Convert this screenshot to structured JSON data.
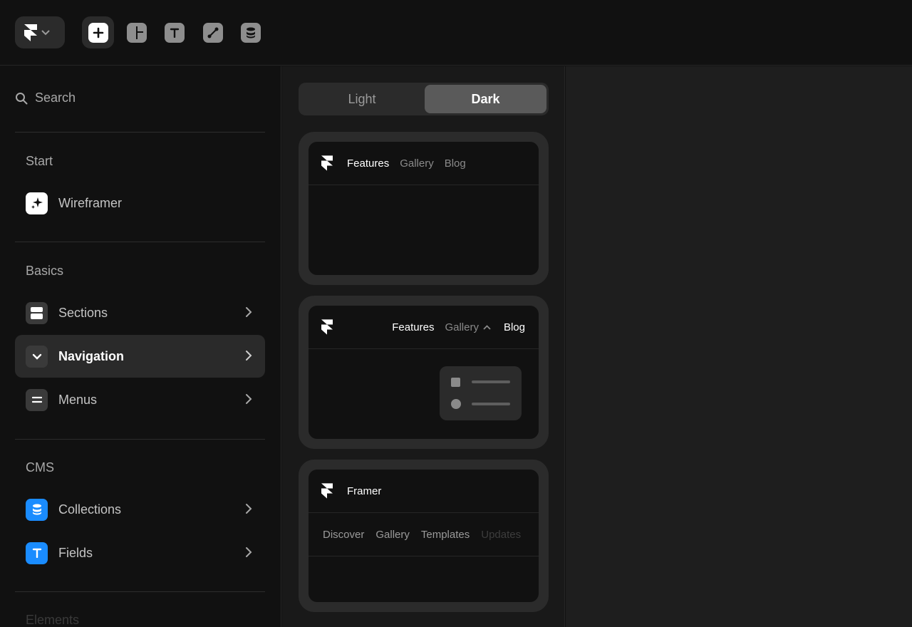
{
  "toolbar": {
    "tools": [
      {
        "icon": "plus-icon",
        "active": true
      },
      {
        "icon": "layout-icon",
        "active": false
      },
      {
        "icon": "text-icon",
        "active": false
      },
      {
        "icon": "vector-icon",
        "active": false
      },
      {
        "icon": "database-icon",
        "active": false
      }
    ]
  },
  "sidebar": {
    "search_label": "Search",
    "start": {
      "title": "Start",
      "items": [
        {
          "label": "Wireframer",
          "icon": "sparkle-icon"
        }
      ]
    },
    "basics": {
      "title": "Basics",
      "items": [
        {
          "label": "Sections",
          "icon": "sections-icon"
        },
        {
          "label": "Navigation",
          "icon": "chevron-down-icon",
          "selected": true
        },
        {
          "label": "Menus",
          "icon": "menu-icon"
        }
      ]
    },
    "cms": {
      "title": "CMS",
      "items": [
        {
          "label": "Collections",
          "icon": "database-icon"
        },
        {
          "label": "Fields",
          "icon": "text-icon"
        }
      ]
    },
    "elements_title": "Elements"
  },
  "theme_toggle": {
    "light": "Light",
    "dark": "Dark",
    "selected": "Dark"
  },
  "previews": {
    "card1": {
      "links": [
        "Features",
        "Gallery",
        "Blog"
      ]
    },
    "card2": {
      "links": [
        "Features",
        "Gallery",
        "Blog"
      ]
    },
    "card3": {
      "brand": "Framer",
      "tabs": [
        "Discover",
        "Gallery",
        "Templates",
        "Updates"
      ]
    }
  },
  "colors": {
    "accent_blue": "#1a8cff",
    "background": "#111111"
  }
}
